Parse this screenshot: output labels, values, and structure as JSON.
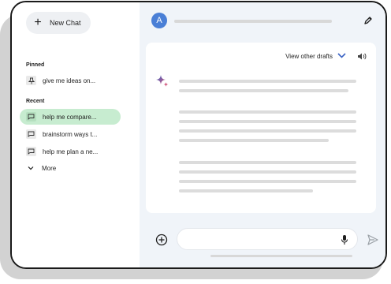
{
  "sidebar": {
    "new_chat_label": "New Chat",
    "pinned_label": "Pinned",
    "pinned_items": [
      {
        "label": "give me ideas on...",
        "icon": "pin-icon"
      }
    ],
    "recent_label": "Recent",
    "recent_items": [
      {
        "label": "help me compare...",
        "icon": "chat-icon",
        "active": true
      },
      {
        "label": "brainstorm ways t...",
        "icon": "chat-icon"
      },
      {
        "label": "help me plan a ne...",
        "icon": "chat-icon"
      }
    ],
    "more_label": "More"
  },
  "header": {
    "avatar_letter": "A"
  },
  "response": {
    "view_drafts_label": "View other drafts"
  },
  "input": {
    "placeholder": ""
  },
  "colors": {
    "active_item": "#c7ecd0",
    "main_background": "#f0f4f9",
    "avatar": "#4a7fd6",
    "accent": "#3b63c4"
  }
}
